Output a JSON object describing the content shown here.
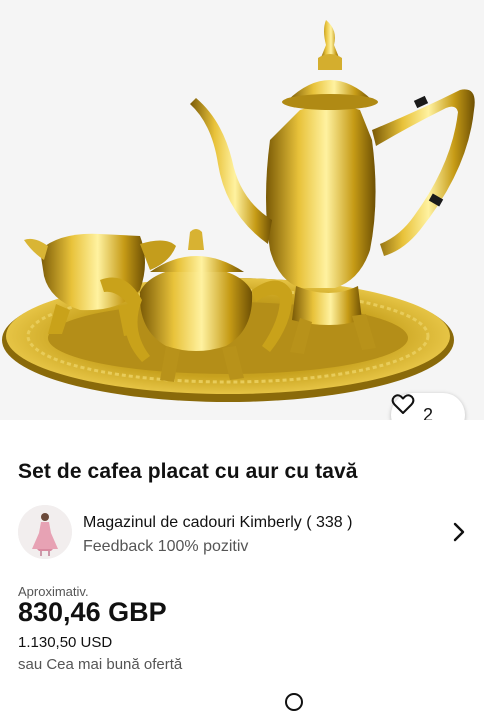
{
  "listing": {
    "image_alt": "gold coffee set",
    "watch_count": "2",
    "title": "Set de cafea placat cu aur cu tavă"
  },
  "seller": {
    "name": "Magazinul de cadouri Kimberly ( 338 )",
    "feedback": "Feedback 100% pozitiv"
  },
  "pricing": {
    "approx_label": "Aproximativ.",
    "price": "830,46 GBP",
    "price_usd": "1.130,50 USD",
    "offer_text": "sau Cea mai bună ofertă"
  },
  "icons": {
    "watch": "heart-icon",
    "seller_link": "chevron-right-icon"
  },
  "colors": {
    "gold": "#c9a21a",
    "background": "#f5f5f5",
    "text": "#111111",
    "secondary_text": "#555555"
  }
}
